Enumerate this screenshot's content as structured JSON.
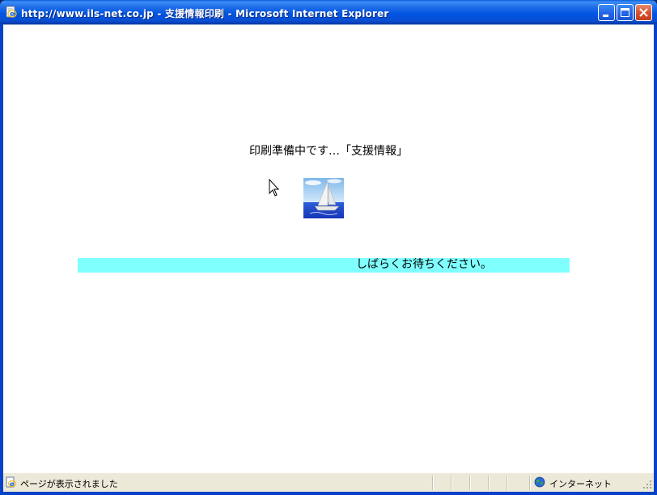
{
  "window": {
    "title": "http://www.ils-net.co.jp - 支援情報印刷 - Microsoft Internet Explorer",
    "icon": "ie-page-icon",
    "buttons": {
      "minimize": "minimize-icon",
      "maximize": "maximize-icon",
      "close": "close-icon"
    }
  },
  "main": {
    "message": "印刷準備中です…「支援情報」",
    "image": "sailboat-image",
    "wait_text": "しばらくお待ちください。",
    "wait_bar_color": "#80ffff"
  },
  "status": {
    "text": "ページが表示されました",
    "zone": "インターネット",
    "zone_icon": "globe-icon"
  }
}
